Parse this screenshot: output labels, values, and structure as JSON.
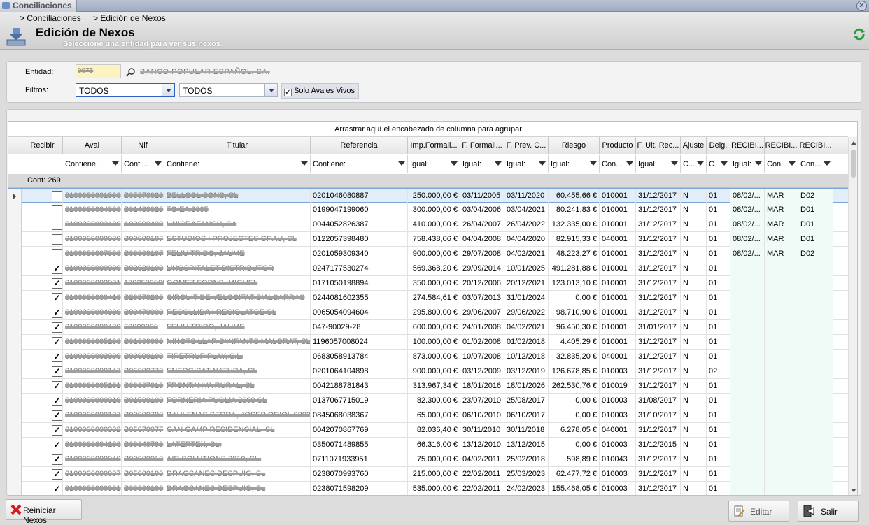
{
  "window": {
    "tab_title": "Conciliaciones"
  },
  "header": {
    "breadcrumbs": [
      "> Conciliaciones",
      "> Edición de Nexos"
    ],
    "title": "Edición de Nexos",
    "subtitle": "Seleccione una entidad para ver sus nexos."
  },
  "filters": {
    "entidad_label": "Entidad:",
    "entidad_code": "0075",
    "entidad_name": "BANCO POPULAR ESPAÑOL, SA.",
    "filtros_label": "Filtros:",
    "filtro1": "TODOS",
    "filtro2": "TODOS",
    "solo_avales_label": "Solo Avales Vivos",
    "solo_avales_checked": true
  },
  "grid": {
    "group_hint": "Arrastrar aquí el encabezado de columna para agrupar",
    "count_label": "Cont: 269",
    "columns": [
      "Recibir",
      "Aval",
      "Nif",
      "Titular",
      "Referencia",
      "Imp.Formali...",
      "F. Formali...",
      "F. Prev. C...",
      "Riesgo",
      "Producto",
      "F. Ult. Rec...",
      "Ajuste",
      "Delg.",
      "RECIBI...",
      "RECIBI...",
      "RECIBI..."
    ],
    "filters": [
      "",
      "Contiene:",
      "Conti...",
      "Contiene:",
      "Contiene:",
      "Igual:",
      "Igual:",
      "Igual:",
      "Igual:",
      "Con...",
      "Igual:",
      "C...",
      "C",
      "Igual:",
      "Con...",
      "Con..."
    ],
    "rows": [
      {
        "chk": false,
        "aval": "0100000001000",
        "nif": "B05070020",
        "titular": "BELLSOL SONS, SL",
        "ref": "0201046080887",
        "imp": "250.000,00 €",
        "ff": "03/11/2005",
        "fp": "03/11/2020",
        "riesgo": "60.455,66 €",
        "prod": "010001",
        "fu": "31/12/2017",
        "aj": "N",
        "delg": "01",
        "r1": "08/02/...",
        "r2": "MAR",
        "r3": "D02"
      },
      {
        "chk": false,
        "aval": "0100000004000",
        "nif": "B01430020",
        "titular": "TOIEA 2005",
        "ref": "0199047199060",
        "imp": "300.000,00 €",
        "ff": "03/04/2006",
        "fp": "03/04/2021",
        "riesgo": "80.241,83 €",
        "prod": "010001",
        "fu": "31/12/2017",
        "aj": "N",
        "delg": "01",
        "r1": "08/02/...",
        "r2": "MAR",
        "r3": "D01"
      },
      {
        "chk": false,
        "aval": "0100000002400",
        "nif": "A00000400",
        "titular": "UNICRAFANCH, SA",
        "ref": "0044052826387",
        "imp": "410.000,00 €",
        "ff": "26/04/2007",
        "fp": "26/04/2022",
        "riesgo": "132.335,00 €",
        "prod": "010001",
        "fu": "31/12/2017",
        "aj": "N",
        "delg": "01",
        "r1": "08/02/...",
        "r2": "MAR",
        "r3": "D01"
      },
      {
        "chk": false,
        "aval": "0100000000000",
        "nif": "B00000107",
        "titular": "ESTUDIOS I PROJECTES GRAU, SL",
        "ref": "0122057398480",
        "imp": "758.438,06 €",
        "ff": "04/04/2008",
        "fp": "04/04/2020",
        "riesgo": "82.915,33 €",
        "prod": "040001",
        "fu": "31/12/2017",
        "aj": "N",
        "delg": "01",
        "r1": "08/02/...",
        "r2": "MAR",
        "r3": "D01"
      },
      {
        "chk": false,
        "aval": "0100000007000",
        "nif": "B00000107",
        "titular": "FELIU TRIDO, JAUME",
        "ref": "0201059309340",
        "imp": "900.000,00 €",
        "ff": "29/07/2008",
        "fp": "04/02/2021",
        "riesgo": "48.223,27 €",
        "prod": "010001",
        "fu": "31/12/2017",
        "aj": "N",
        "delg": "01",
        "r1": "08/02/...",
        "r2": "MAR",
        "r3": "D02"
      },
      {
        "chk": true,
        "aval": "0100000000000",
        "nif": "B02020100",
        "titular": "L'HOSPITALET DISTRIBUTOR",
        "ref": "0247177530274",
        "imp": "569.368,20 €",
        "ff": "29/09/2014",
        "fp": "10/01/2025",
        "riesgo": "491.281,88 €",
        "prod": "010001",
        "fu": "31/12/2017",
        "aj": "N",
        "delg": "01",
        "r1": "",
        "r2": "",
        "r3": ""
      },
      {
        "chk": true,
        "aval": "0100000002001",
        "nif": "1702590000",
        "titular": "GOMEZ FORNS, MIGUEL",
        "ref": "0171050198894",
        "imp": "350.000,00 €",
        "ff": "20/12/2006",
        "fp": "20/12/2021",
        "riesgo": "123.013,10 €",
        "prod": "010001",
        "fu": "31/12/2017",
        "aj": "N",
        "delg": "01",
        "r1": "",
        "r2": "",
        "r3": ""
      },
      {
        "chk": true,
        "aval": "0100000000410",
        "nif": "B20370200",
        "titular": "CIRCUIT DE VELOCITAT D'ALCARRAS",
        "ref": "0244081602355",
        "imp": "274.584,61 €",
        "ff": "03/07/2013",
        "fp": "31/01/2024",
        "riesgo": "0,00 €",
        "prod": "010001",
        "fu": "31/12/2017",
        "aj": "N",
        "delg": "01",
        "r1": "",
        "r2": "",
        "r3": ""
      },
      {
        "chk": true,
        "aval": "0100000004000",
        "nif": "B00470000",
        "titular": "RECOLLIDA I RECICLATGE SL",
        "ref": "0065054094604",
        "imp": "295.800,00 €",
        "ff": "29/06/2007",
        "fp": "29/06/2022",
        "riesgo": "98.710,90 €",
        "prod": "010001",
        "fu": "31/12/2017",
        "aj": "N",
        "delg": "01",
        "r1": "",
        "r2": "",
        "r3": ""
      },
      {
        "chk": true,
        "aval": "0100000000400",
        "nif": "70000000",
        "titular": "FELIU TRIDO, JAUME",
        "ref": "047-90029-28",
        "imp": "600.000,00 €",
        "ff": "24/01/2008",
        "fp": "04/02/2021",
        "riesgo": "96.450,30 €",
        "prod": "010001",
        "fu": "31/01/2017",
        "aj": "N",
        "delg": "01",
        "r1": "",
        "r2": "",
        "r3": ""
      },
      {
        "chk": true,
        "aval": "0100000005100",
        "nif": "B01000000",
        "titular": "NINOTS LLAR D'INFANTS MALGRAT, SL",
        "ref": "1196057008024",
        "imp": "100.000,00 €",
        "ff": "01/02/2008",
        "fp": "01/02/2018",
        "riesgo": "4.405,29 €",
        "prod": "010001",
        "fu": "31/12/2017",
        "aj": "N",
        "delg": "01",
        "r1": "",
        "r2": "",
        "r3": ""
      },
      {
        "chk": true,
        "aval": "0100000003000",
        "nif": "B00000100",
        "titular": "TIRETRUP PLAY, S.L.",
        "ref": "0683058913784",
        "imp": "873.000,00 €",
        "ff": "10/07/2008",
        "fp": "10/12/2018",
        "riesgo": "32.835,20 €",
        "prod": "040001",
        "fu": "31/12/2017",
        "aj": "N",
        "delg": "01",
        "r1": "",
        "r2": "",
        "r3": ""
      },
      {
        "chk": true,
        "aval": "0100000000147",
        "nif": "B05000770",
        "titular": "ENERGISAT NATURA, SL",
        "ref": "0201064104898",
        "imp": "900.000,00 €",
        "ff": "03/12/2009",
        "fp": "03/12/2019",
        "riesgo": "126.678,85 €",
        "prod": "010003",
        "fu": "31/12/2017",
        "aj": "N",
        "delg": "02",
        "r1": "",
        "r2": "",
        "r3": ""
      },
      {
        "chk": true,
        "aval": "0100000005101",
        "nif": "B00007010",
        "titular": "FRONTANYA RURAL, SL",
        "ref": "0042188781843",
        "imp": "313.967,34 €",
        "ff": "18/01/2016",
        "fp": "18/01/2026",
        "riesgo": "262.530,76 €",
        "prod": "010019",
        "fu": "31/12/2017",
        "aj": "N",
        "delg": "01",
        "r1": "",
        "r2": "",
        "r3": ""
      },
      {
        "chk": true,
        "aval": "0100000000010",
        "nif": "B01500100",
        "titular": "FORNERIA PUGLIA 2008 SL",
        "ref": "0137067715019",
        "imp": "82.300,00 €",
        "ff": "23/07/2010",
        "fp": "25/08/2017",
        "riesgo": "0,00 €",
        "prod": "010003",
        "fu": "31/08/2017",
        "aj": "N",
        "delg": "01",
        "r1": "",
        "r2": "",
        "r3": ""
      },
      {
        "chk": true,
        "aval": "0100000000137",
        "nif": "B00000700",
        "titular": "BAULENAS SERRA, JOSEP ORIOL 02020",
        "ref": "0845068038367",
        "imp": "65.000,00 €",
        "ff": "06/10/2010",
        "fp": "06/10/2017",
        "riesgo": "0,00 €",
        "prod": "010003",
        "fu": "31/10/2017",
        "aj": "N",
        "delg": "01",
        "r1": "",
        "r2": "",
        "r3": ""
      },
      {
        "chk": true,
        "aval": "0100000000302",
        "nif": "B05070077",
        "titular": "CAN GAMP RESIDENCIAL, SL",
        "ref": "0042070867769",
        "imp": "82.036,40 €",
        "ff": "30/11/2010",
        "fp": "30/11/2018",
        "riesgo": "6.278,05 €",
        "prod": "040001",
        "fu": "31/12/2017",
        "aj": "N",
        "delg": "01",
        "r1": "",
        "r2": "",
        "r3": ""
      },
      {
        "chk": true,
        "aval": "0100000004100",
        "nif": "B00040700",
        "titular": "LATERTEX, SL.",
        "ref": "0350071489855",
        "imp": "66.316,00 €",
        "ff": "13/12/2010",
        "fp": "13/12/2015",
        "riesgo": "0,00 €",
        "prod": "010003",
        "fu": "31/12/2015",
        "aj": "N",
        "delg": "01",
        "r1": "",
        "r2": "",
        "r3": ""
      },
      {
        "chk": true,
        "aval": "0100000000040",
        "nif": "B00000010",
        "titular": "AIR SOLUTIONS 2010, SL.",
        "ref": "0711071933951",
        "imp": "75.000,00 €",
        "ff": "04/02/2011",
        "fp": "25/02/2018",
        "riesgo": "598,89 €",
        "prod": "010043",
        "fu": "31/12/2017",
        "aj": "N",
        "delg": "01",
        "r1": "",
        "r2": "",
        "r3": ""
      },
      {
        "chk": true,
        "aval": "0100000000007",
        "nif": "B05000100",
        "titular": "DRAGSANES DESPUIG, SL",
        "ref": "0238070993760",
        "imp": "215.000,00 €",
        "ff": "22/02/2011",
        "fp": "25/03/2023",
        "riesgo": "62.477,72 €",
        "prod": "010003",
        "fu": "31/12/2017",
        "aj": "N",
        "delg": "01",
        "r1": "",
        "r2": "",
        "r3": ""
      },
      {
        "chk": true,
        "aval": "0100000000001",
        "nif": "B00000100",
        "titular": "DRAGSANES DESPUIG, SL",
        "ref": "0238071598209",
        "imp": "535.000,00 €",
        "ff": "22/02/2011",
        "fp": "24/02/2023",
        "riesgo": "155.468,05 €",
        "prod": "010003",
        "fu": "31/12/2017",
        "aj": "N",
        "delg": "01",
        "r1": "",
        "r2": "",
        "r3": ""
      }
    ]
  },
  "buttons": {
    "reiniciar": "Reiniciar Nexos",
    "editar": "Editar",
    "salir": "Salir"
  },
  "colors": {
    "title_bar": "#9fabbf",
    "selection": "#e1edf8",
    "recibir_cols": "#f0faf7"
  }
}
